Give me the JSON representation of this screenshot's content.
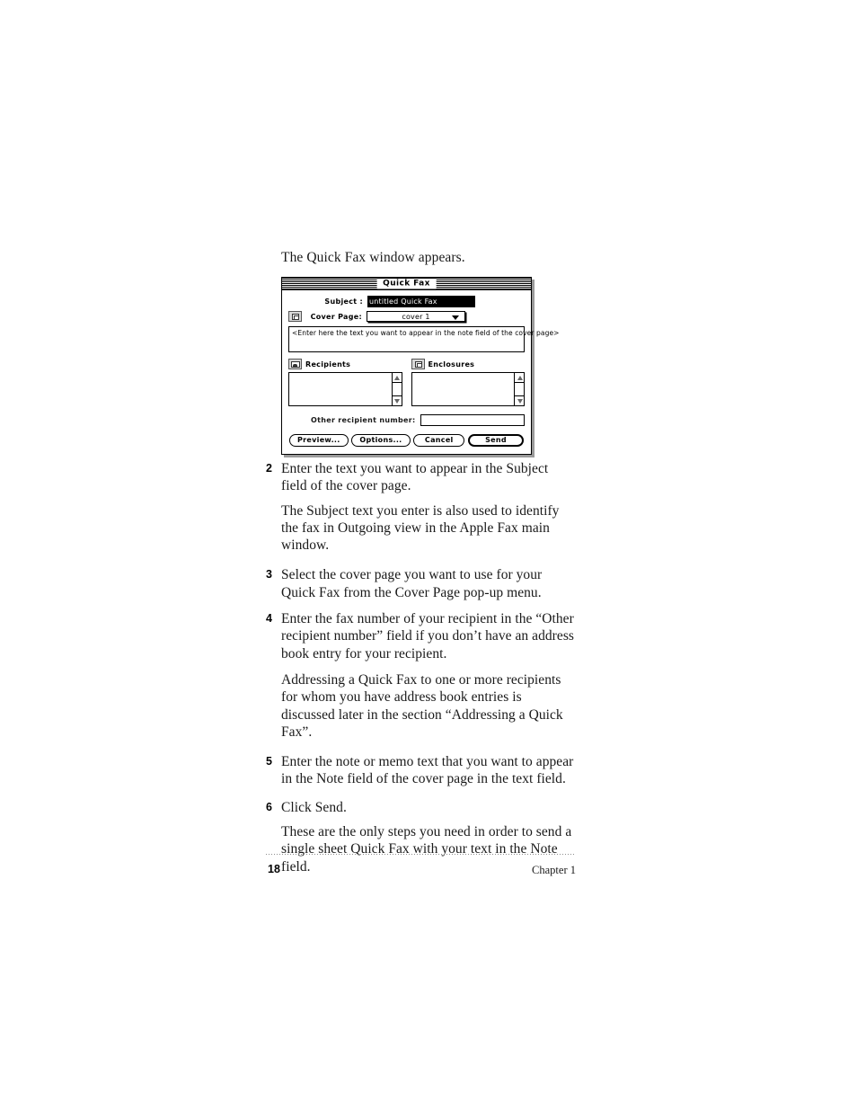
{
  "page": {
    "intro_line": "The Quick Fax window appears.",
    "footer_page_number": "18",
    "footer_chapter": "Chapter 1"
  },
  "dialog": {
    "title": "Quick Fax",
    "subject": {
      "label": "Subject :",
      "value": "untitled Quick Fax"
    },
    "cover_page": {
      "label": "Cover Page:",
      "selected": "cover 1",
      "icon": "document-icon"
    },
    "note_field": {
      "placeholder": "<Enter here the text you want to appear in the note field of the cover page>"
    },
    "recipients": {
      "label": "Recipients",
      "icon": "address-card-icon",
      "items": []
    },
    "enclosures": {
      "label": "Enclosures",
      "icon": "document-icon",
      "items": []
    },
    "other_recipient": {
      "label": "Other recipient number:",
      "value": ""
    },
    "buttons": {
      "preview": "Preview...",
      "options": "Options...",
      "cancel": "Cancel",
      "send": "Send"
    }
  },
  "steps": [
    {
      "number": "2",
      "text": "Enter the text you want to appear in the Subject field of the cover page.",
      "note": "The Subject text you enter is also used to identify the fax in Outgoing view in the Apple Fax main window."
    },
    {
      "number": "3",
      "text": "Select the cover page you want to use for your Quick Fax from the Cover Page pop-up menu.",
      "note": ""
    },
    {
      "number": "4",
      "text": "Enter the fax number of your recipient in the “Other recipient number” field if you don’t have an address book entry for your recipient.",
      "note": "Addressing a Quick Fax to one or more recipients for whom you have address book entries is discussed later in the section “Addressing a Quick Fax”."
    },
    {
      "number": "5",
      "text": "Enter the note or memo text that you want to appear in the Note field of the cover page in the text field.",
      "note": ""
    },
    {
      "number": "6",
      "text": "Click Send.",
      "note": "These are the only steps you need in order to send a single sheet Quick Fax with your text in the Note field."
    }
  ]
}
